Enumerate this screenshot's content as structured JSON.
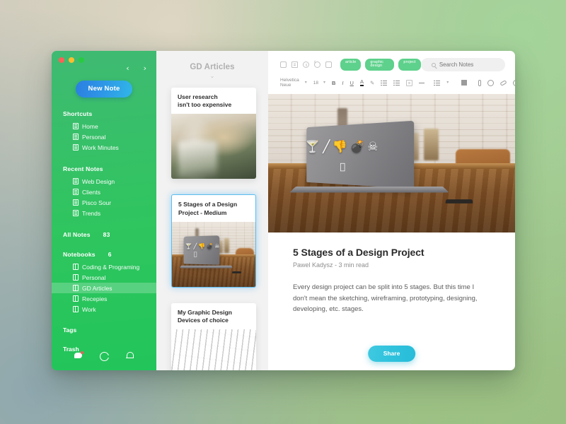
{
  "window": {
    "traffic_lights": [
      "close",
      "minimize",
      "zoom"
    ],
    "nav_back": "‹",
    "nav_forward": "›"
  },
  "sidebar": {
    "new_note_label": "New Note",
    "sections": [
      {
        "title": "Shortcuts",
        "count": "",
        "items": [
          {
            "label": "Home",
            "icon": "note-icon",
            "active": false
          },
          {
            "label": "Personal",
            "icon": "note-icon",
            "active": false
          },
          {
            "label": "Work Minutes",
            "icon": "note-icon",
            "active": false
          }
        ]
      },
      {
        "title": "Recent Notes",
        "count": "",
        "items": [
          {
            "label": "Web Design",
            "icon": "note-icon",
            "active": false
          },
          {
            "label": "Clients",
            "icon": "note-icon",
            "active": false
          },
          {
            "label": "Pisco Sour",
            "icon": "note-icon",
            "active": false
          },
          {
            "label": "Trends",
            "icon": "note-icon",
            "active": false
          }
        ]
      },
      {
        "title": "All Notes",
        "count": "83",
        "items": []
      },
      {
        "title": "Notebooks",
        "count": "6",
        "items": [
          {
            "label": "Coding & Programing",
            "icon": "notebook-icon",
            "active": false
          },
          {
            "label": "Personal",
            "icon": "notebook-icon",
            "active": false
          },
          {
            "label": "GD Articles",
            "icon": "notebook-icon",
            "active": true
          },
          {
            "label": "Recepies",
            "icon": "notebook-icon",
            "active": false
          },
          {
            "label": "Work",
            "icon": "notebook-icon",
            "active": false
          }
        ]
      }
    ],
    "tags_label": "Tags",
    "trash_label": "Trash",
    "footer_icons": [
      "chat-icon",
      "sync-icon",
      "bell-icon"
    ],
    "colors": {
      "background_top": "#3fba72",
      "background_bottom": "#22c55a",
      "new_note_gradient_start": "#2b7fe0",
      "new_note_gradient_end": "#30b6e8"
    }
  },
  "notelist": {
    "title": "GD Articles",
    "chevron": "⌄",
    "cards": [
      {
        "title": "User research\nisn't too expensive",
        "selected": false,
        "thumb": "woman-reading-photo"
      },
      {
        "title": "5 Stages of a Design\nProject - Medium",
        "selected": true,
        "thumb": "laptop-on-desk-photo"
      },
      {
        "title": "My Graphic Design\nDevices of choice",
        "selected": false,
        "thumb": "keyboard-photo"
      }
    ]
  },
  "editor": {
    "toolbar": {
      "icons": [
        "checkbox-icon",
        "play-icon",
        "clock-icon",
        "info-icon",
        "attachment-icon"
      ],
      "tags": [
        "article",
        "graphic design",
        "project"
      ],
      "tag_color": "#5ed18c"
    },
    "search": {
      "placeholder": "Search Notes",
      "value": ""
    },
    "format": {
      "font_family": "Helvetica Neue",
      "font_size": "18",
      "bold": "B",
      "italic": "I",
      "underline": "U",
      "text_color": "A",
      "highlighter": "highlighter-icon",
      "bullet_list": "bullet-list-icon",
      "numbered_list": "numbered-list-icon",
      "checklist": "checklist-icon",
      "horizontal_rule": "horizontal-rule-icon",
      "align": "align-icon",
      "table": "table-icon",
      "attachment": "paperclip-icon",
      "emoji": "emoji-icon",
      "link": "link-icon",
      "more": "more-icon"
    },
    "hero_image": "laptop-with-stickers-on-wooden-desk",
    "note": {
      "title": "5 Stages of a Design Project",
      "meta": "Pawel Kadysz - 3 min read",
      "body": "Every design project can be split into 5 stages. But this time I don't mean the sketching, wireframing, prototyping, designing, developing, etc. stages."
    },
    "share_label": "Share",
    "share_color": "#2fc2dd"
  }
}
